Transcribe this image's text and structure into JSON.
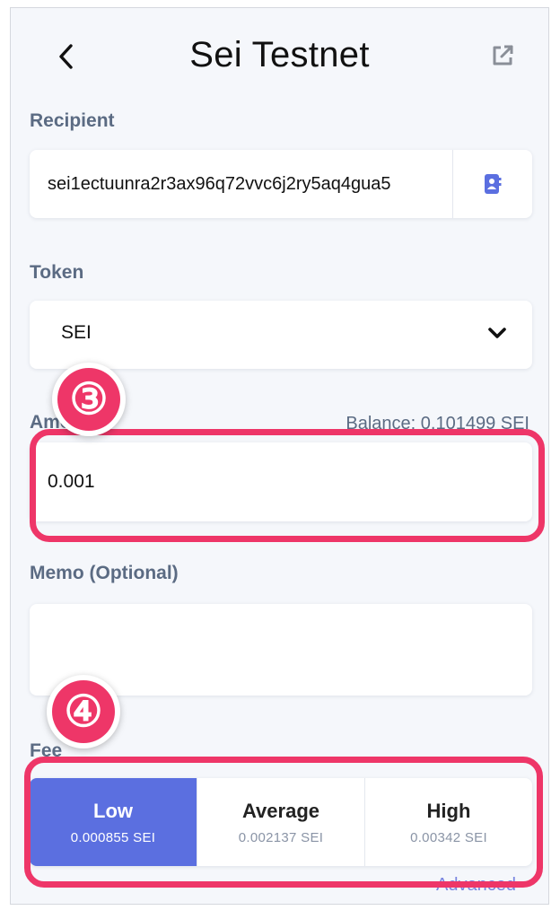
{
  "header": {
    "title": "Sei Testnet",
    "back_icon": "chevron-left-icon",
    "external_icon": "external-link-icon"
  },
  "recipient": {
    "label": "Recipient",
    "value": "sei1ectuunra2r3ax96q72vvc6j2ry5aq4gua5",
    "addressbook_icon": "address-book-icon"
  },
  "token": {
    "label": "Token",
    "selected": "SEI",
    "dropdown_icon": "chevron-down-icon"
  },
  "amount": {
    "label": "Amount",
    "value": "0.001",
    "balance": "Balance: 0.101499 SEI"
  },
  "memo": {
    "label": "Memo (Optional)",
    "value": ""
  },
  "fee": {
    "label": "Fee",
    "options": [
      {
        "name": "Low",
        "amount": "0.000855 SEI",
        "selected": true
      },
      {
        "name": "Average",
        "amount": "0.002137 SEI",
        "selected": false
      },
      {
        "name": "High",
        "amount": "0.00342 SEI",
        "selected": false
      }
    ],
    "advanced": "Advanced"
  },
  "annotations": {
    "step3": "③",
    "step4": "④",
    "highlight_color": "#ee3668"
  },
  "colors": {
    "accent": "#5b6fe0",
    "label": "#5b6b83",
    "background": "#f5f7fb"
  }
}
